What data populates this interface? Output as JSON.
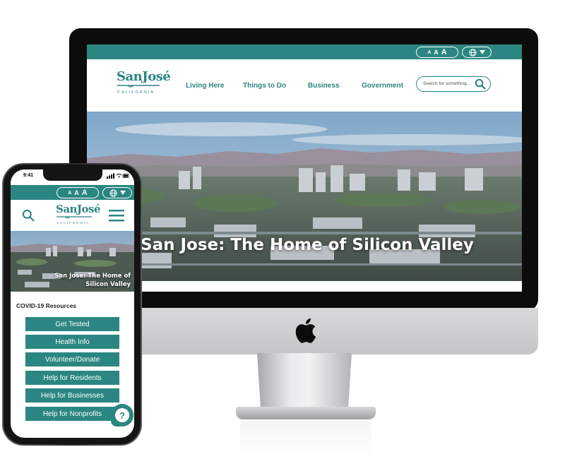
{
  "brand": {
    "logo_main": "SanJosé",
    "logo_sub": "CALIFORNIA",
    "accent_color": "#2b8681"
  },
  "desktop": {
    "text_size_labels": [
      "A",
      "A",
      "A"
    ],
    "nav": [
      "Living Here",
      "Things to Do",
      "Business",
      "Government"
    ],
    "search": {
      "placeholder": "Search for something..."
    },
    "hero_title": "San Jose: The Home of Silicon Valley"
  },
  "mobile": {
    "status_time": "9:41",
    "text_size_labels": [
      "A",
      "A",
      "A"
    ],
    "hero_title": "San Jose: The Home of Silicon Valley",
    "covid_heading": "COVID-19 Resources",
    "buttons": [
      "Get Tested",
      "Health Info",
      "Volunteer/Donate",
      "Help for Residents",
      "Help for Businesses",
      "Help for Nonprofits"
    ],
    "help_label": "?"
  },
  "icons": {
    "globe": "globe-icon",
    "dropdown": "chevron-down-icon",
    "search": "search-icon",
    "menu": "hamburger-menu-icon",
    "help": "help-question-icon",
    "apple": "apple-logo-icon"
  }
}
